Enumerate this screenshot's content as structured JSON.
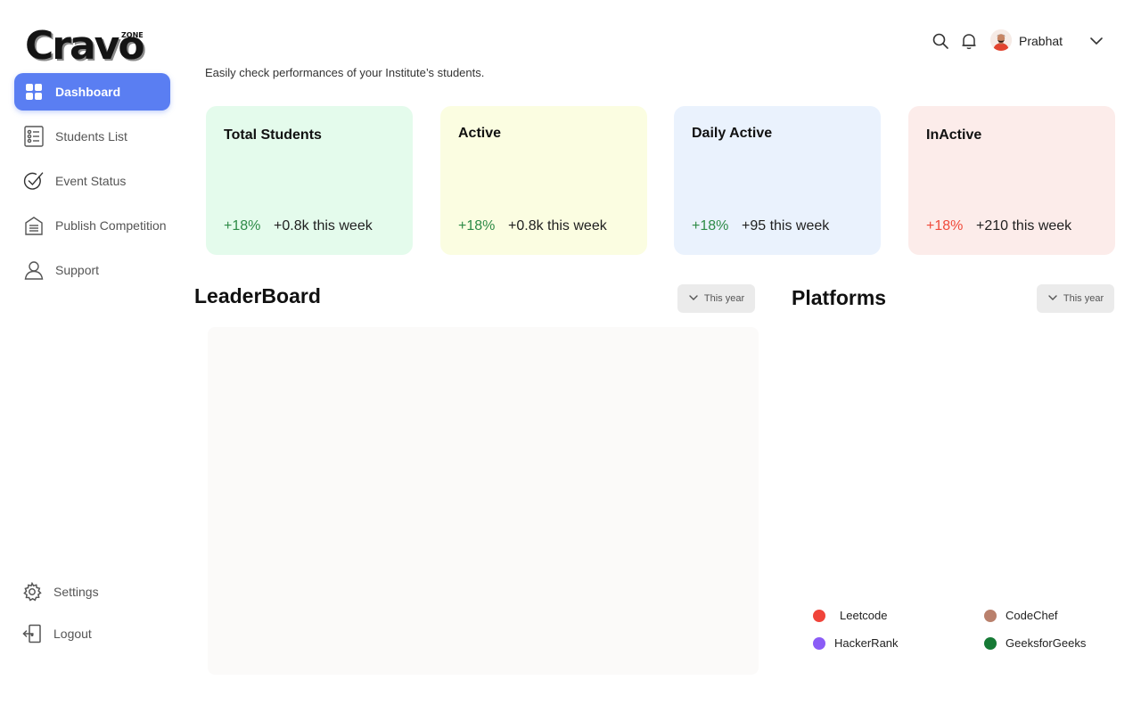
{
  "brand": {
    "logo_text": "Cravo",
    "logo_sub": "ZONE"
  },
  "sidebar": {
    "items": [
      {
        "label": "Dashboard",
        "icon": "dashboard-icon",
        "active": true
      },
      {
        "label": "Students List",
        "icon": "students-list-icon"
      },
      {
        "label": "Event Status",
        "icon": "event-status-icon"
      },
      {
        "label": "Publish Competition",
        "icon": "publish-competition-icon"
      },
      {
        "label": "Support",
        "icon": "support-icon"
      }
    ],
    "bottom": [
      {
        "label": "Settings",
        "icon": "gear-icon"
      },
      {
        "label": "Logout",
        "icon": "logout-icon"
      }
    ]
  },
  "header": {
    "user_name": "Prabhat"
  },
  "subtitle": "Easily check performances of your Institute’s students.",
  "cards": [
    {
      "title": "Total Students",
      "pct": "+18%",
      "week": "+0.8k this week",
      "bg": "#e4fbec",
      "trend": "up"
    },
    {
      "title": "Active",
      "pct": "+18%",
      "week": "+0.8k this week",
      "bg": "#fbfde1",
      "trend": "up"
    },
    {
      "title": "Daily Active",
      "pct": "+18%",
      "week": "+95 this week",
      "bg": "#eaf2fd",
      "trend": "up"
    },
    {
      "title": "InActive",
      "pct": "+18%",
      "week": "+210 this week",
      "bg": "#fcecea",
      "trend": "down"
    }
  ],
  "leaderboard": {
    "title": "LeaderBoard",
    "filter": "This year"
  },
  "platforms": {
    "title": "Platforms",
    "filter": "This year",
    "legend": [
      {
        "label": "Leetcode",
        "color": "#f0443a"
      },
      {
        "label": "CodeChef",
        "color": "#b9806c"
      },
      {
        "label": "HackerRank",
        "color": "#8b5cf6"
      },
      {
        "label": "GeeksforGeeks",
        "color": "#167a35"
      }
    ]
  },
  "colors": {
    "accent": "#5a7ef2",
    "positive": "#2e8b47",
    "negative": "#f04a3a"
  }
}
